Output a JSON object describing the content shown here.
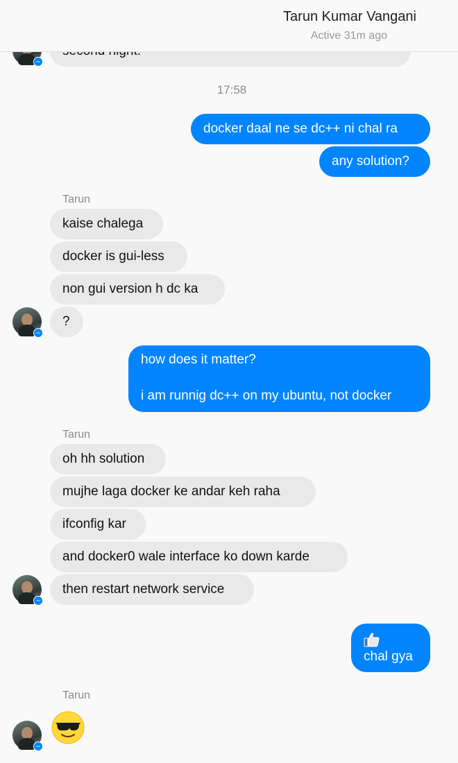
{
  "header": {
    "contact_name": "Tarun Kumar Vangani",
    "status": "Active 31m ago"
  },
  "top_partial": {
    "text": "second night."
  },
  "timestamp": "17:58",
  "messages": [
    {
      "from": "me",
      "text": "docker daal ne se dc++ ni chal ra"
    },
    {
      "from": "me",
      "text": "any solution?"
    },
    {
      "from": "Tarun",
      "sender_label": "Tarun",
      "text": "kaise chalega"
    },
    {
      "from": "Tarun",
      "text": "docker is gui-less"
    },
    {
      "from": "Tarun",
      "text": "non gui version h dc ka"
    },
    {
      "from": "Tarun",
      "text": "?"
    },
    {
      "from": "me",
      "lines": [
        "how does it matter?",
        "i am runnig dc++ on my ubuntu, not docker"
      ]
    },
    {
      "from": "Tarun",
      "sender_label": "Tarun",
      "text": "oh hh solution"
    },
    {
      "from": "Tarun",
      "text": "mujhe laga docker ke andar keh raha"
    },
    {
      "from": "Tarun",
      "text": "ifconfig kar"
    },
    {
      "from": "Tarun",
      "text": "and docker0 wale interface ko down karde"
    },
    {
      "from": "Tarun",
      "text": "then restart network service"
    },
    {
      "from": "me",
      "icon": "thumbs-up-icon",
      "text": "chal gya"
    },
    {
      "from": "Tarun",
      "sender_label": "Tarun",
      "icon": "sunglasses-emoji-icon"
    }
  ],
  "colors": {
    "outgoing_bubble": "#0084ff",
    "incoming_bubble": "#e9e9e9",
    "background": "#f9f9f9"
  }
}
